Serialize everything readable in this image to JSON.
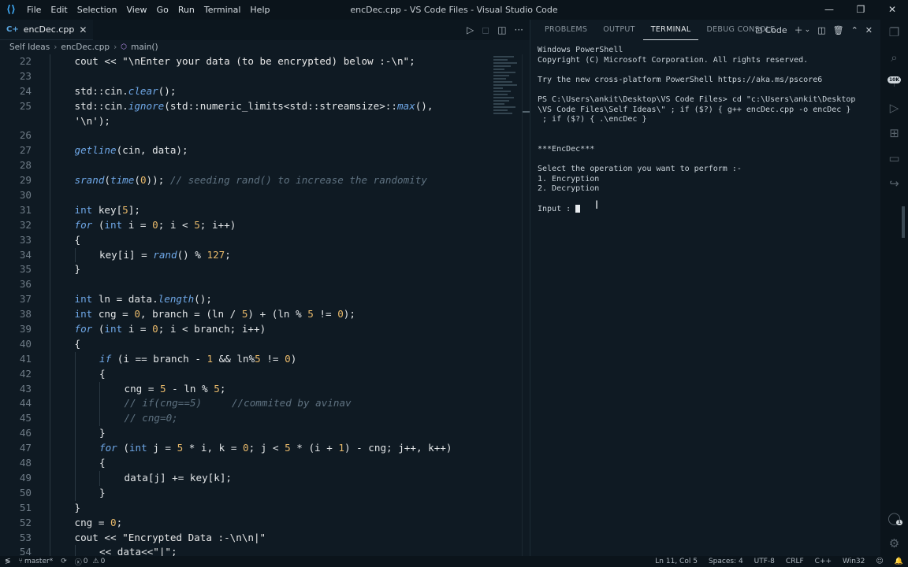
{
  "window": {
    "title": "encDec.cpp - VS Code Files - Visual Studio Code",
    "menu": [
      "File",
      "Edit",
      "Selection",
      "View",
      "Go",
      "Run",
      "Terminal",
      "Help"
    ]
  },
  "editor": {
    "tab_label": "encDec.cpp",
    "breadcrumb": [
      "Self Ideas",
      "encDec.cpp",
      "main()"
    ],
    "lines": [
      {
        "n": "22",
        "indent": 2,
        "html": "cout &lt;&lt; <span class=\"str\">\"\\nEnter your data (to be encrypted) below :-\\n\"</span>;"
      },
      {
        "n": "23",
        "indent": 0,
        "html": ""
      },
      {
        "n": "24",
        "indent": 2,
        "html": "std::cin.<span class=\"fn\">clear</span>();"
      },
      {
        "n": "25",
        "indent": 2,
        "html": "std::cin.<span class=\"fn\">ignore</span>(std::numeric_limits&lt;std::streamsize&gt;::<span class=\"fn\">max</span>(),"
      },
      {
        "n": "",
        "indent": 2,
        "html": "<span class=\"str\">'\\n'</span>);"
      },
      {
        "n": "26",
        "indent": 0,
        "html": ""
      },
      {
        "n": "27",
        "indent": 2,
        "html": "<span class=\"fn\">getline</span>(cin, data);"
      },
      {
        "n": "28",
        "indent": 0,
        "html": ""
      },
      {
        "n": "29",
        "indent": 2,
        "html": "<span class=\"fn\">srand</span>(<span class=\"fn\">time</span>(<span class=\"num\">0</span>)); <span class=\"cm\">// seeding rand() to increase the randomity</span>"
      },
      {
        "n": "30",
        "indent": 0,
        "html": ""
      },
      {
        "n": "31",
        "indent": 2,
        "html": "<span class=\"ty\">int</span> key[<span class=\"num\">5</span>];"
      },
      {
        "n": "32",
        "indent": 2,
        "html": "<span class=\"kw\">for</span> (<span class=\"ty\">int</span> i = <span class=\"num\">0</span>; i &lt; <span class=\"num\">5</span>; i++)"
      },
      {
        "n": "33",
        "indent": 2,
        "html": "{"
      },
      {
        "n": "34",
        "indent": 3,
        "html": "key[i] = <span class=\"fn\">rand</span>() % <span class=\"num\">127</span>;"
      },
      {
        "n": "35",
        "indent": 2,
        "html": "}"
      },
      {
        "n": "36",
        "indent": 0,
        "html": ""
      },
      {
        "n": "37",
        "indent": 2,
        "html": "<span class=\"ty\">int</span> ln = data.<span class=\"fn\">length</span>();"
      },
      {
        "n": "38",
        "indent": 2,
        "html": "<span class=\"ty\">int</span> cng = <span class=\"num\">0</span>, branch = (ln / <span class=\"num\">5</span>) + (ln % <span class=\"num\">5</span> != <span class=\"num\">0</span>);"
      },
      {
        "n": "39",
        "indent": 2,
        "html": "<span class=\"kw\">for</span> (<span class=\"ty\">int</span> i = <span class=\"num\">0</span>; i &lt; branch; i++)"
      },
      {
        "n": "40",
        "indent": 2,
        "html": "{"
      },
      {
        "n": "41",
        "indent": 3,
        "html": "<span class=\"kw\">if</span> (i == branch - <span class=\"num\">1</span> &amp;&amp; ln%<span class=\"num\">5</span> != <span class=\"num\">0</span>)"
      },
      {
        "n": "42",
        "indent": 3,
        "html": "{"
      },
      {
        "n": "43",
        "indent": 4,
        "html": "cng = <span class=\"num\">5</span> - ln % <span class=\"num\">5</span>;"
      },
      {
        "n": "44",
        "indent": 4,
        "html": "<span class=\"cm\">// if(cng==5)     //commited by avinav</span>"
      },
      {
        "n": "45",
        "indent": 4,
        "html": "<span class=\"cm\">// cng=0;</span>"
      },
      {
        "n": "46",
        "indent": 3,
        "html": "}"
      },
      {
        "n": "47",
        "indent": 3,
        "html": "<span class=\"kw\">for</span> (<span class=\"ty\">int</span> j = <span class=\"num\">5</span> * i, k = <span class=\"num\">0</span>; j &lt; <span class=\"num\">5</span> * (i + <span class=\"num\">1</span>) - cng; j++, k++)"
      },
      {
        "n": "48",
        "indent": 3,
        "html": "{"
      },
      {
        "n": "49",
        "indent": 4,
        "html": "data[j] += key[k];"
      },
      {
        "n": "50",
        "indent": 3,
        "html": "}"
      },
      {
        "n": "51",
        "indent": 2,
        "html": "}"
      },
      {
        "n": "52",
        "indent": 2,
        "html": "cng = <span class=\"num\">0</span>;"
      },
      {
        "n": "53",
        "indent": 2,
        "html": "cout &lt;&lt; <span class=\"str\">\"Encrypted Data :-\\n\\n|\"</span>"
      },
      {
        "n": "54",
        "indent": 3,
        "html": "&lt;&lt; data&lt;&lt;<span class=\"str\">\"|\"</span>;"
      }
    ]
  },
  "panel": {
    "tabs": [
      "PROBLEMS",
      "OUTPUT",
      "TERMINAL",
      "DEBUG CONSOLE"
    ],
    "active_tab": "TERMINAL",
    "shell_label": "Code",
    "terminal_lines": [
      "Windows PowerShell",
      "Copyright (C) Microsoft Corporation. All rights reserved.",
      "",
      "Try the new cross-platform PowerShell https://aka.ms/pscore6",
      "",
      "PS C:\\Users\\ankit\\Desktop\\VS Code Files> cd \"c:\\Users\\ankit\\Desktop",
      "\\VS Code Files\\Self Ideas\\\" ; if ($?) { g++ encDec.cpp -o encDec }",
      " ; if ($?) { .\\encDec }",
      "",
      "",
      "***EncDec***",
      "",
      "Select the operation you want to perform :-",
      "1. Encryption",
      "2. Decryption",
      "",
      "Input : "
    ]
  },
  "activity": {
    "badge": "10K",
    "account_badge": "1"
  },
  "status": {
    "branch": "master*",
    "problems": "0",
    "warnings": "0",
    "position": "Ln 11, Col 5",
    "spaces": "Spaces: 4",
    "encoding": "UTF-8",
    "eol": "CRLF",
    "language": "C++",
    "platform": "Win32"
  }
}
